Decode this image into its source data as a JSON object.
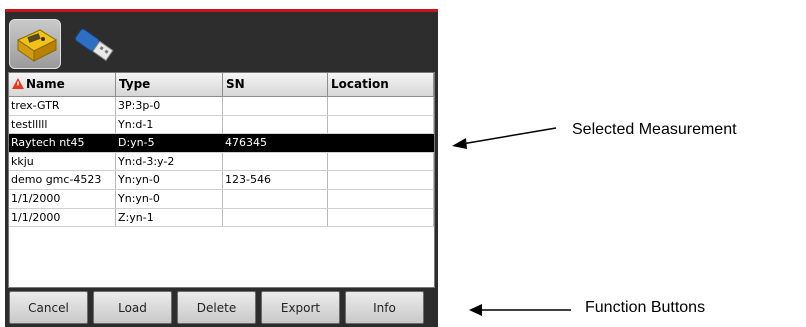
{
  "toolbar": {
    "icons": [
      "measurement-device-icon",
      "usb-drive-icon"
    ]
  },
  "table": {
    "columns": [
      "Name",
      "Type",
      "SN",
      "Location"
    ],
    "rows": [
      {
        "name": "trex-GTR",
        "type": "3P:3p-0",
        "sn": "",
        "location": ""
      },
      {
        "name": "testlllll",
        "type": "Yn:d-1",
        "sn": "",
        "location": ""
      },
      {
        "name": "Raytech nt45",
        "type": "D:yn-5",
        "sn": "476345",
        "location": ""
      },
      {
        "name": "kkju",
        "type": "Yn:d-3:y-2",
        "sn": "",
        "location": ""
      },
      {
        "name": "demo gmc-4523",
        "type": "Yn:yn-0",
        "sn": "123-546",
        "location": ""
      },
      {
        "name": "1/1/2000",
        "type": "Yn:yn-0",
        "sn": "",
        "location": ""
      },
      {
        "name": "1/1/2000",
        "type": "Z:yn-1",
        "sn": "",
        "location": ""
      }
    ],
    "selected_row": 2
  },
  "buttons": {
    "cancel": "Cancel",
    "load": "Load",
    "delete": "Delete",
    "export": "Export",
    "info": "Info"
  },
  "annotations": {
    "selected": "Selected Measurement",
    "functions": "Function Buttons"
  }
}
